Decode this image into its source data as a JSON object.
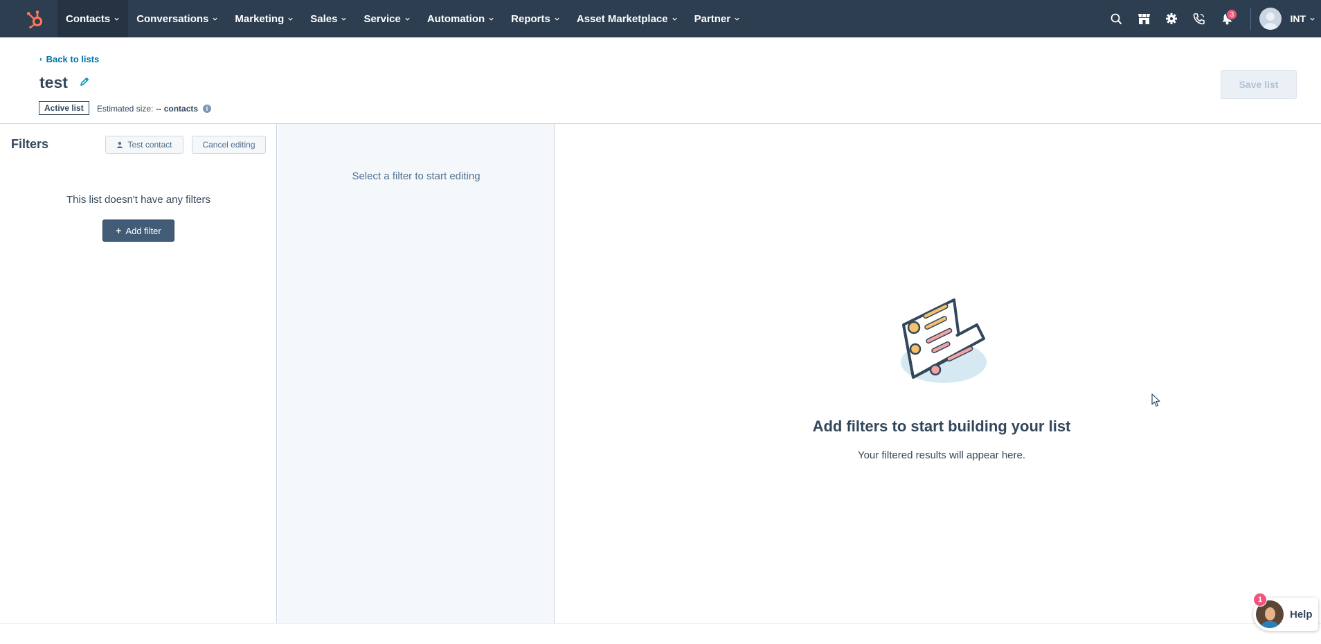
{
  "nav": {
    "items": [
      {
        "label": "Contacts",
        "active": true
      },
      {
        "label": "Conversations"
      },
      {
        "label": "Marketing"
      },
      {
        "label": "Sales"
      },
      {
        "label": "Service"
      },
      {
        "label": "Automation"
      },
      {
        "label": "Reports"
      },
      {
        "label": "Asset Marketplace"
      },
      {
        "label": "Partner"
      }
    ],
    "notification_count": "3",
    "account_label": "INT",
    "icons": [
      "search-icon",
      "marketplace-icon",
      "settings-icon",
      "calling-icon",
      "notifications-icon"
    ]
  },
  "header": {
    "back_label": "Back to lists",
    "list_name": "test",
    "list_type_tag": "Active list",
    "estimated_size_label": "Estimated size:",
    "estimated_size_value": "-- contacts",
    "save_label": "Save list"
  },
  "filters": {
    "title": "Filters",
    "test_contact_label": "Test contact",
    "cancel_label": "Cancel editing",
    "empty_text": "This list doesn't have any filters",
    "add_filter_label": "Add filter"
  },
  "editor": {
    "placeholder_text": "Select a filter to start editing"
  },
  "empty_state": {
    "title": "Add filters to start building your list",
    "subtitle": "Your filtered results will appear here."
  },
  "help": {
    "label": "Help",
    "badge": "1"
  },
  "colors": {
    "nav_bg": "#2d3e50",
    "accent_orange": "#ff7a59",
    "link": "#0073a8",
    "badge": "#f2547d",
    "primary_button": "#425b76"
  }
}
